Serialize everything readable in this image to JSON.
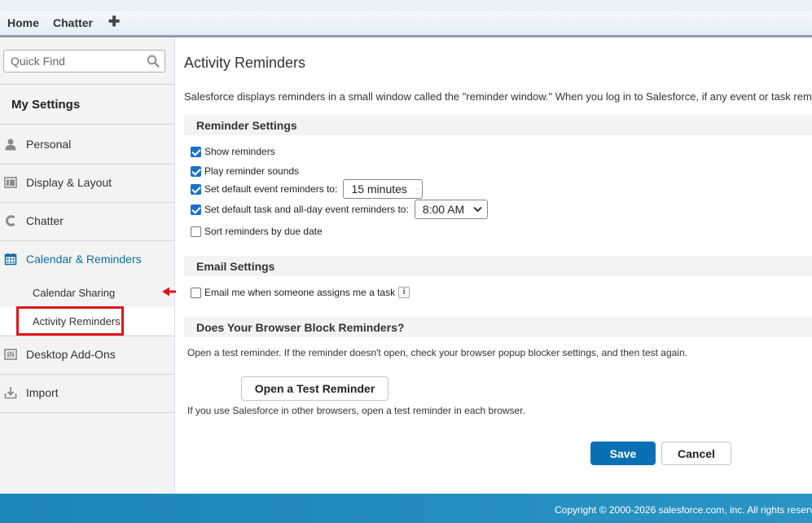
{
  "topnav": {
    "tabs": [
      "Home",
      "Chatter"
    ],
    "add_icon": "plus-icon"
  },
  "sidebar": {
    "quick_find_placeholder": "Quick Find",
    "heading": "My Settings",
    "items": [
      {
        "label": "Personal",
        "icon": "person-icon"
      },
      {
        "label": "Display & Layout",
        "icon": "layout-icon"
      },
      {
        "label": "Chatter",
        "icon": "chatter-icon"
      },
      {
        "label": "Calendar & Reminders",
        "icon": "calendar-icon"
      },
      {
        "label": "Desktop Add-Ons",
        "icon": "addons-icon"
      },
      {
        "label": "Import",
        "icon": "import-icon"
      }
    ],
    "sub_items": [
      "Calendar Sharing",
      "Activity Reminders"
    ],
    "selected_sub_item": "Activity Reminders"
  },
  "main": {
    "title": "Activity Reminders",
    "intro": "Salesforce displays reminders in a small window called the \"reminder window.\" When you log in to Salesforce, if any event or task rem",
    "reminder_settings": {
      "heading": "Reminder Settings",
      "show_reminders": "Show reminders",
      "play_sounds": "Play reminder sounds",
      "default_event": "Set default event reminders to:",
      "default_event_value": "15 minutes",
      "default_task": "Set default task and all-day event reminders to:",
      "default_task_value": "8:00 AM",
      "sort_by_due": "Sort reminders by due date"
    },
    "email_settings": {
      "heading": "Email Settings",
      "email_assign": "Email me when someone assigns me a task",
      "info_icon": "i"
    },
    "browser_block": {
      "heading": "Does Your Browser Block Reminders?",
      "text1": "Open a test reminder. If the reminder doesn't open, check your browser popup blocker settings, and then test again.",
      "button": "Open a Test Reminder",
      "text2": "If you use Salesforce in other browsers, open a test reminder in each browser."
    },
    "save_label": "Save",
    "cancel_label": "Cancel"
  },
  "footer": {
    "copyright": "Copyright © 2000-2026 salesforce.com, inc. All rights reserv"
  },
  "colors": {
    "accent": "#0a70b4",
    "highlight": "#e3141b",
    "footer": "#1d86b8"
  }
}
